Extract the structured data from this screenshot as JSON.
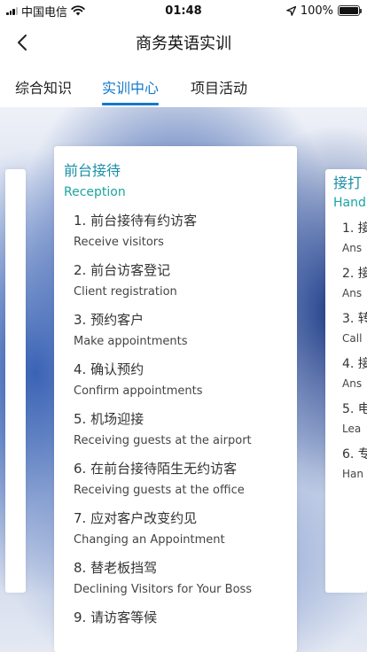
{
  "status": {
    "carrier": "中国电信",
    "time": "01:48",
    "battery": "100%",
    "battery_level": 1.0
  },
  "header": {
    "title": "商务英语实训"
  },
  "tabs": [
    {
      "label": "综合知识"
    },
    {
      "label": "实训中心",
      "active": true
    },
    {
      "label": "项目活动"
    }
  ],
  "cards": {
    "main": {
      "title": "前台接待",
      "subtitle": "Reception",
      "lessons": [
        {
          "cn": "1. 前台接待有约访客",
          "en": "Receive visitors"
        },
        {
          "cn": "2. 前台访客登记",
          "en": "Client registration"
        },
        {
          "cn": "3. 预约客户",
          "en": "Make appointments"
        },
        {
          "cn": "4. 确认预约",
          "en": "Confirm appointments"
        },
        {
          "cn": "5. 机场迎接",
          "en": "Receiving guests at the airport"
        },
        {
          "cn": "6. 在前台接待陌生无约访客",
          "en": "Receiving guests at the office"
        },
        {
          "cn": "7. 应对客户改变约见",
          "en": "Changing an Appointment"
        },
        {
          "cn": "8. 替老板挡驾",
          "en": "Declining Visitors for Your Boss"
        },
        {
          "cn": "9. 请访客等候",
          "en": ""
        }
      ]
    },
    "right": {
      "title": "接打",
      "subtitle": "Hand",
      "lessons": [
        {
          "cn": "1. 接",
          "en": "Ans"
        },
        {
          "cn": "2. 接",
          "en": "Ans"
        },
        {
          "cn": "3. 转",
          "en": "Call"
        },
        {
          "cn": "4. 接",
          "en": "Ans"
        },
        {
          "cn": "5. 电",
          "en": "Lea"
        },
        {
          "cn": "6. 专",
          "en": "Han"
        }
      ]
    }
  },
  "colors": {
    "accent": "#1479c9",
    "card_title": "#1a8fa6"
  }
}
